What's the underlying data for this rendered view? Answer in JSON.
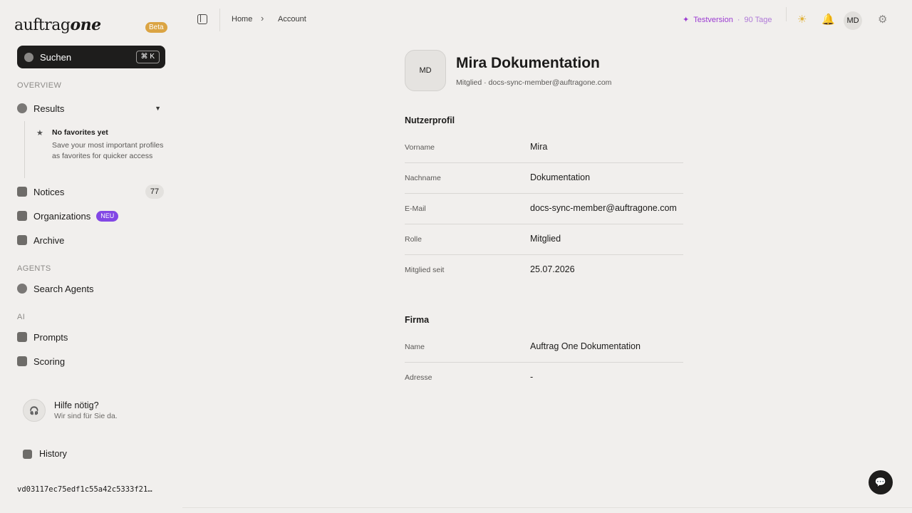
{
  "sidebar": {
    "logo_regular": "auftrag",
    "logo_bold": "one",
    "beta_badge": "Beta",
    "search_label": "Suchen",
    "search_shortcut": "⌘ K",
    "section_overview": "OVERVIEW",
    "results_label": "Results",
    "favorites_title": "No favorites yet",
    "favorites_text": "Save your most important profiles as favorites for quicker access",
    "notices_label": "Notices",
    "notices_count": "77",
    "organizations_label": "Organizations",
    "organizations_badge": "NEU",
    "archive_label": "Archive",
    "section_agents": "AGENTS",
    "search_agents_label": "Search Agents",
    "section_ai": "AI",
    "prompts_label": "Prompts",
    "scoring_label": "Scoring",
    "help_title": "Hilfe nötig?",
    "help_subtitle": "Wir sind für Sie da.",
    "history_label": "History",
    "version": "vd03117ec75edf1c55a42c5333f21…"
  },
  "topbar": {
    "breadcrumb_home": "Home",
    "breadcrumb_separator": "›",
    "breadcrumb_current": "Account",
    "trial_label": "Testversion",
    "trial_separator": "·",
    "trial_days": "90 Tage",
    "avatar_initials": "MD"
  },
  "profile": {
    "avatar_initials": "MD",
    "name": "Mira Dokumentation",
    "subtitle": "Mitglied · docs-sync-member@auftragone.com"
  },
  "user_profile": {
    "title": "Nutzerprofil",
    "fields": [
      {
        "label": "Vorname",
        "value": "Mira"
      },
      {
        "label": "Nachname",
        "value": "Dokumentation"
      },
      {
        "label": "E-Mail",
        "value": "docs-sync-member@auftragone.com"
      },
      {
        "label": "Rolle",
        "value": "Mitglied"
      },
      {
        "label": "Mitglied seit",
        "value": "25.07.2026"
      }
    ]
  },
  "company": {
    "title": "Firma",
    "fields": [
      {
        "label": "Name",
        "value": "Auftrag One Dokumentation"
      },
      {
        "label": "Adresse",
        "value": "-"
      }
    ]
  },
  "colors": {
    "accent_purple": "#8247e5",
    "trial_purple": "#9b3bd1",
    "beta_orange": "#dba443",
    "sidebar_bg": "#f1efed",
    "dark": "#1e1d1c"
  },
  "icons": [
    "search-icon",
    "results-icon",
    "star-icon",
    "notices-icon",
    "organizations-icon",
    "archive-icon",
    "search-agents-icon",
    "prompts-icon",
    "scoring-icon",
    "headset-icon",
    "history-icon",
    "panel-toggle-icon",
    "sparkle-icon",
    "sun-icon",
    "bell-icon",
    "gear-icon",
    "chat-icon"
  ]
}
